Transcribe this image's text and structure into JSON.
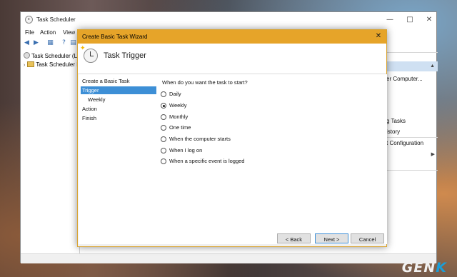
{
  "background_window": {
    "title": "Task Scheduler",
    "menu": [
      "File",
      "Action",
      "View"
    ],
    "tree": [
      "Task Scheduler (Loc",
      "Task Scheduler Li"
    ],
    "actions_panel": {
      "items": [
        "er Computer...",
        "g Tasks",
        "istory",
        "t Configuration"
      ]
    }
  },
  "wizard": {
    "title": "Create Basic Task Wizard",
    "close_glyph": "✕",
    "heading": "Task Trigger",
    "steps": [
      {
        "label": "Create a Basic Task",
        "sub": false,
        "selected": false
      },
      {
        "label": "Trigger",
        "sub": false,
        "selected": true
      },
      {
        "label": "Weekly",
        "sub": true,
        "selected": false
      },
      {
        "label": "Action",
        "sub": false,
        "selected": false
      },
      {
        "label": "Finish",
        "sub": false,
        "selected": false
      }
    ],
    "question": "When do you want the task to start?",
    "options": [
      {
        "label": "Daily",
        "checked": false
      },
      {
        "label": "Weekly",
        "checked": true
      },
      {
        "label": "Monthly",
        "checked": false
      },
      {
        "label": "One time",
        "checked": false
      },
      {
        "label": "When the computer starts",
        "checked": false
      },
      {
        "label": "When I log on",
        "checked": false
      },
      {
        "label": "When a specific event is logged",
        "checked": false
      }
    ],
    "buttons": {
      "back": "< Back",
      "next": "Next >",
      "cancel": "Cancel"
    }
  },
  "watermark": {
    "text_main": "GEN",
    "text_accent": "K"
  },
  "colors": {
    "wizard_titlebar": "#e6a429",
    "selection": "#3d8fd6"
  },
  "icons": {
    "window_controls": [
      "minimize-icon",
      "maximize-icon",
      "close-icon"
    ],
    "wizard": [
      "task-clock-icon",
      "radio-button-icon"
    ]
  }
}
